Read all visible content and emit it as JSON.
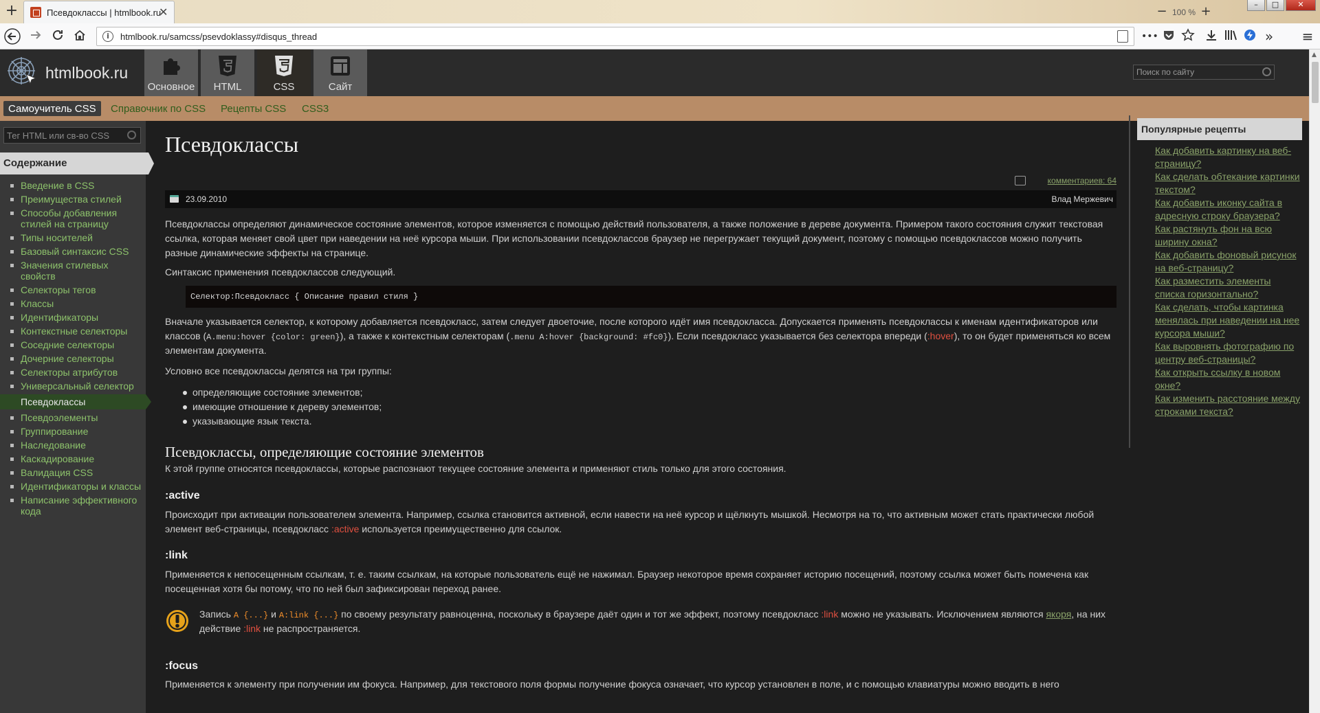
{
  "browser": {
    "tab_title": "Псевдоклассы | htmlbook.ru",
    "new_tab": "+",
    "tab_close": "✕",
    "zoom_minus": "−",
    "zoom_level": "100 %",
    "zoom_plus": "+",
    "url": "htmlbook.ru/samcss/psevdoklassy#disqus_thread",
    "toolbar_more": "•••",
    "toolbar_overflow": "»",
    "toolbar_menu": "≡"
  },
  "site": {
    "logo_text": "htmlbook.ru",
    "sections": [
      {
        "label": "Основное",
        "icon": "puzzle-icon"
      },
      {
        "label": "HTML",
        "icon": "html5-icon"
      },
      {
        "label": "CSS",
        "icon": "css3-icon"
      },
      {
        "label": "Сайт",
        "icon": "site-layout-icon"
      }
    ],
    "search_placeholder": "Поиск по сайту",
    "subnav": [
      "Самоучитель CSS",
      "Справочник по CSS",
      "Рецепты CSS",
      "CSS3"
    ]
  },
  "sidebar": {
    "search_placeholder": "Тег HTML или св-во CSS",
    "contents_title": "Содержание",
    "items": [
      "Введение в CSS",
      "Преимущества стилей",
      "Способы добавления стилей на страницу",
      "Типы носителей",
      "Базовый синтаксис CSS",
      "Значения стилевых свойств",
      "Селекторы тегов",
      "Классы",
      "Идентификаторы",
      "Контекстные селекторы",
      "Соседние селекторы",
      "Дочерние селекторы",
      "Селекторы атрибутов",
      "Универсальный селектор",
      "Псевдоклассы",
      "Псевдоэлементы",
      "Группирование",
      "Наследование",
      "Каскадирование",
      "Валидация CSS",
      "Идентификаторы и классы",
      "Написание эффективного кода"
    ]
  },
  "article": {
    "title": "Псевдоклассы",
    "comments": "комментариев: 64",
    "date": "23.09.2010",
    "author": "Влад Мержевич",
    "intro": "Псевдоклассы определяют динамическое состояние элементов, которое изменяется с помощью действий пользователя, а также положение в дереве документа. Примером такого состояния служит текстовая ссылка, которая меняет свой цвет при наведении на неё курсора мыши. При использовании псевдоклассов браузер не перегружает текущий документ, поэтому с помощью псевдоклассов можно получить разные динамические эффекты на странице.",
    "syntax_intro": "Синтаксис применения псевдоклассов следующий.",
    "syntax_code": "Селектор:Псевдокласс { Описание правил стиля }",
    "p3": {
      "a": "Вначале указывается селектор, к которому добавляется псевдокласс, затем следует двоеточие, после которого идёт имя псевдокласса. Допускается применять псевдоклассы к именам идентификаторов или классов (",
      "code1": "A.menu:hover {color: green}",
      "b": "), а также к контекстным селекторам (",
      "code2": ".menu A:hover {background: #fc0}",
      "c": "). Если псевдокласс указывается без селектора впереди (",
      "kw": ":hover",
      "d": "), то он будет применяться ко всем элементам документа."
    },
    "groups_intro": "Условно все псевдоклассы делятся на три группы:",
    "groups": [
      "определяющие состояние элементов;",
      "имеющие отношение к дереву элементов;",
      "указывающие язык текста."
    ],
    "h2": "Псевдоклассы, определяющие состояние элементов",
    "h2_text": "К этой группе относятся псевдоклассы, которые распознают текущее состояние элемента и применяют стиль только для этого состояния.",
    "active_h": ":active",
    "active_p": {
      "a": "Происходит при активации пользователем элемента. Например, ссылка становится активной, если навести на неё курсор и щёлкнуть мышкой. Несмотря на то, что активным может стать практически любой элемент веб-страницы, псевдокласс ",
      "kw": ":active",
      "b": " используется преимущественно для ссылок."
    },
    "link_h": ":link",
    "link_p": "Применяется к непосещенным ссылкам, т. е. таким ссылкам, на которые пользователь ещё не нажимал. Браузер некоторое время сохраняет историю посещений, поэтому ссылка может быть помечена как посещенная хотя бы потому, что по ней был зафиксирован переход ранее.",
    "note": {
      "a": "Запись ",
      "code1": "A {...}",
      "b": " и ",
      "code2": "A:link {...}",
      "c": " по своему результату равноценна, поскольку в браузере даёт один и тот же эффект, поэтому псевдокласс ",
      "kw1": ":link",
      "d": " можно не указывать. Исключением являются ",
      "anchor": "якоря",
      "e": ", на них действие ",
      "kw2": ":link",
      "f": " не распространяется."
    },
    "focus_h": ":focus",
    "focus_p": "Применяется к элементу при получении им фокуса. Например, для текстового поля формы получение фокуса означает, что курсор установлен в поле, и с помощью клавиатуры можно вводить в него"
  },
  "popular": {
    "title": "Популярные рецепты",
    "items": [
      "Как добавить картинку на веб-страницу?",
      "Как сделать обтекание картинки текстом?",
      "Как добавить иконку сайта в адресную строку браузера?",
      "Как растянуть фон на всю ширину окна?",
      "Как добавить фоновый рисунок на веб-страницу?",
      "Как разместить элементы списка горизонтально?",
      "Как сделать, чтобы картинка менялась при наведении на нее курсора мыши?",
      "Как выровнять фотографию по центру веб-страницы?",
      "Как открыть ссылку в новом окне?",
      "Как изменить расстояние между строками текста?"
    ]
  }
}
